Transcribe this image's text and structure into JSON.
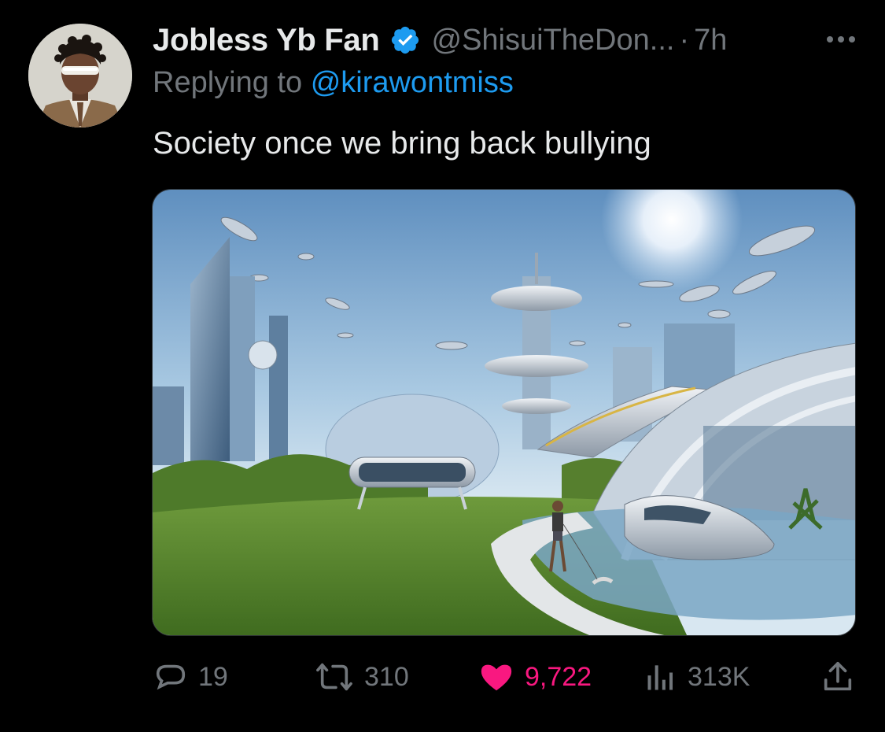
{
  "author": {
    "display_name": "Jobless Yb Fan",
    "handle": "@ShisuiTheDon...",
    "separator": "·",
    "time": "7h",
    "verified_icon": "verified-badge-icon",
    "verified_color": "#1d9bf0"
  },
  "reply": {
    "prefix": "Replying to",
    "mention": "@kirawontmiss"
  },
  "tweet": {
    "text": "Society once we bring back bullying"
  },
  "media": {
    "icon": "futuristic-city-image"
  },
  "metrics": {
    "replies": "19",
    "retweets": "310",
    "likes": "9,722",
    "views": "313K"
  },
  "colors": {
    "background": "#000000",
    "primary_text": "#e7e9ea",
    "secondary_text": "#71767b",
    "link": "#1d9bf0",
    "like": "#f91880"
  }
}
